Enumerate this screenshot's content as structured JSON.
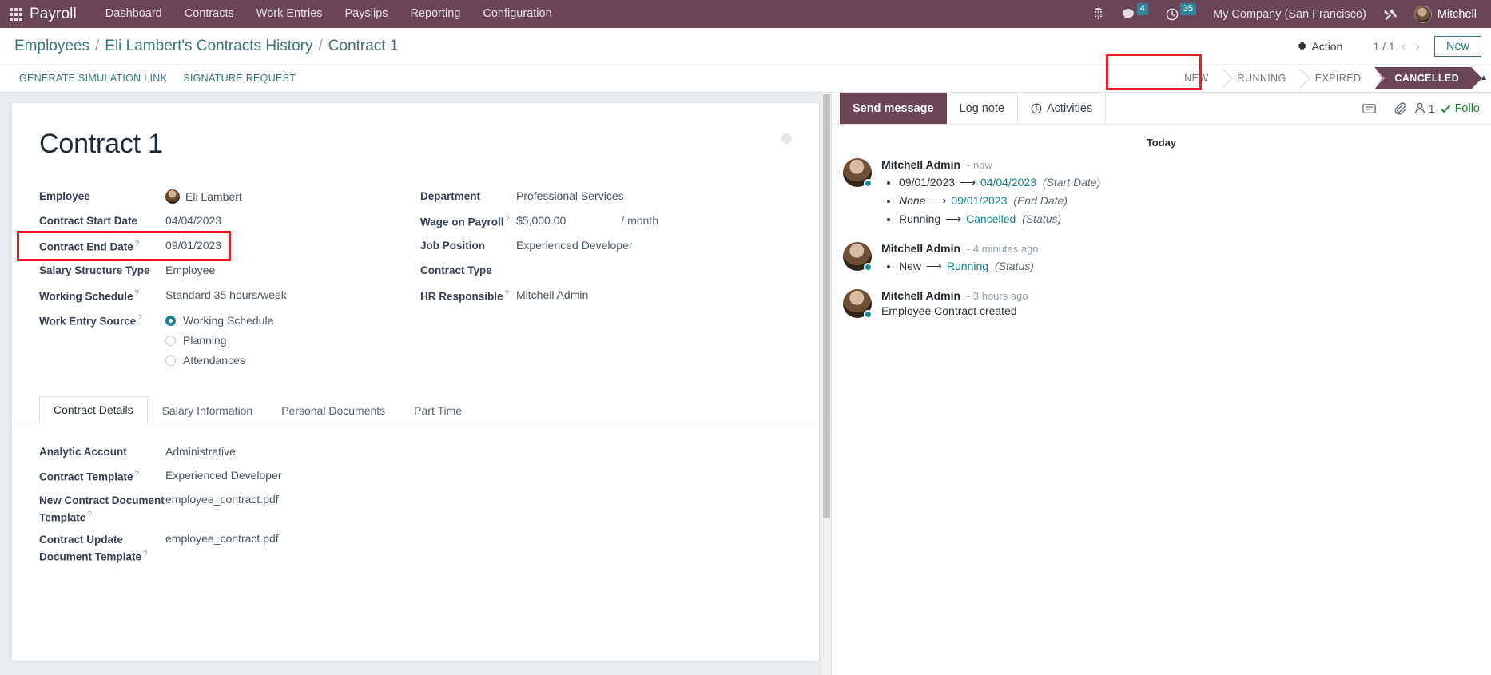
{
  "navbar": {
    "apps_icon": "apps-grid-icon",
    "brand": "Payroll",
    "menus": [
      "Dashboard",
      "Contracts",
      "Work Entries",
      "Payslips",
      "Reporting",
      "Configuration"
    ],
    "right": {
      "switchboard_icon": "phone-keypad-icon",
      "messages_icon": "chat-bubble-icon",
      "messages_count": "4",
      "activities_icon": "clock-icon",
      "activities_count": "35",
      "company": "My Company (San Francisco)",
      "debug_icon": "wrench-tools-icon",
      "user_avatar": "user-avatar",
      "user_name": "Mitchell"
    }
  },
  "control_panel": {
    "breadcrumb": {
      "root": "Employees",
      "parent": "Eli Lambert's Contracts History",
      "current": "Contract 1",
      "separator": "/"
    },
    "action_button": "Action",
    "action_icon": "gear-icon",
    "pager": "1 / 1",
    "prev_icon": "chevron-left-icon",
    "next_icon": "chevron-right-icon",
    "new_button": "New",
    "buttons": [
      "GENERATE SIMULATION LINK",
      "SIGNATURE REQUEST"
    ],
    "statusbar": {
      "stages": [
        "NEW",
        "RUNNING",
        "EXPIRED",
        "CANCELLED"
      ],
      "active": "CANCELLED",
      "collapse_icon": "caret-up-icon",
      "highlight_color": "#ee1c25"
    }
  },
  "form": {
    "title": "Contract 1",
    "smart_button_placeholder": "status-dot",
    "left_fields": [
      {
        "label": "Employee",
        "value": "Eli Lambert",
        "help": false,
        "avatar": true
      },
      {
        "label": "Contract Start Date",
        "value": "04/04/2023",
        "help": false
      },
      {
        "label": "Contract End Date",
        "value": "09/01/2023",
        "help": true,
        "highlighted": true
      },
      {
        "label": "Salary Structure Type",
        "value": "Employee",
        "help": false
      },
      {
        "label": "Working Schedule",
        "value": "Standard 35 hours/week",
        "help": true
      }
    ],
    "work_entry_source": {
      "label": "Work Entry Source",
      "help": true,
      "options": [
        "Working Schedule",
        "Planning",
        "Attendances"
      ],
      "selected": "Working Schedule"
    },
    "right_fields": [
      {
        "label": "Department",
        "value": "Professional Services",
        "help": false
      },
      {
        "label": "Wage on Payroll",
        "value": "$5,000.00",
        "help": true,
        "unit": "/ month"
      },
      {
        "label": "Job Position",
        "value": "Experienced Developer",
        "help": false
      },
      {
        "label": "Contract Type",
        "value": "",
        "help": false
      },
      {
        "label": "HR Responsible",
        "value": "Mitchell Admin",
        "help": true
      }
    ],
    "tabs": [
      {
        "label": "Contract Details",
        "active": true
      },
      {
        "label": "Salary Information",
        "active": false
      },
      {
        "label": "Personal Documents",
        "active": false
      },
      {
        "label": "Part Time",
        "active": false
      }
    ],
    "tab_fields": [
      {
        "label": "Analytic Account",
        "value": "Administrative",
        "help": false
      },
      {
        "label": "Contract Template",
        "value": "Experienced Developer",
        "help": true
      },
      {
        "label": "New Contract Document Template",
        "value": "employee_contract.pdf",
        "help": true
      },
      {
        "label": "Contract Update Document Template",
        "value": "employee_contract.pdf",
        "help": true
      }
    ]
  },
  "chatter": {
    "send_message": "Send message",
    "log_note": "Log note",
    "activities": "Activities",
    "activities_icon": "clock-icon",
    "attach_icon": "paperclip-icon",
    "note_icon": "note-icon",
    "followers_icon": "user-icon",
    "followers_count": "1",
    "follow_icon": "check-icon",
    "follow_label": "Follo",
    "day_separator": "Today",
    "messages": [
      {
        "author": "Mitchell Admin",
        "time": "- now",
        "tracking": [
          {
            "old": "09/01/2023",
            "new": "04/04/2023",
            "field": "(Start Date)",
            "old_italic": false
          },
          {
            "old": "None",
            "new": "09/01/2023",
            "field": "(End Date)",
            "old_italic": true
          },
          {
            "old": "Running",
            "new": "Cancelled",
            "field": "(Status)",
            "old_italic": false
          }
        ]
      },
      {
        "author": "Mitchell Admin",
        "time": "- 4 minutes ago",
        "tracking": [
          {
            "old": "New",
            "new": "Running",
            "field": "(Status)",
            "old_italic": false
          }
        ]
      },
      {
        "author": "Mitchell Admin",
        "time": "- 3 hours ago",
        "body": "Employee Contract created"
      }
    ]
  }
}
